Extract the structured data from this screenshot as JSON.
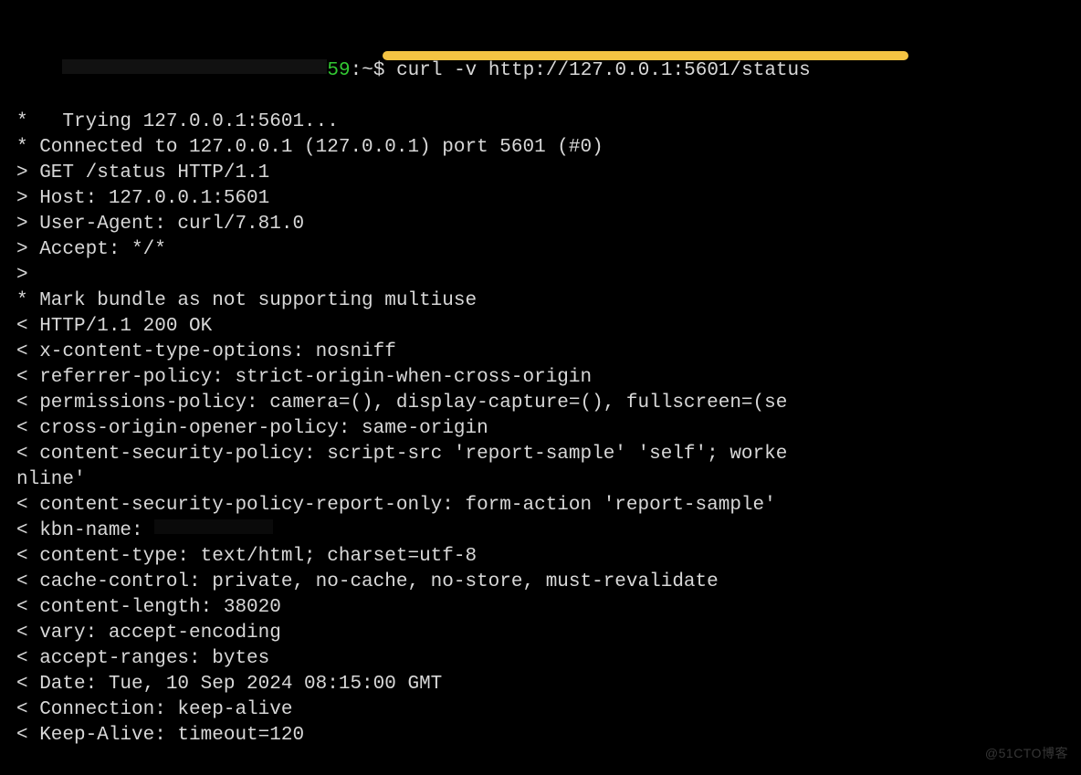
{
  "prompt": {
    "visible_fragment_a": "59",
    "path": ":~$",
    "command": "curl -v http://127.0.0.1:5601/status"
  },
  "lines": {
    "l01": "*   Trying 127.0.0.1:5601...",
    "l02": "* Connected to 127.0.0.1 (127.0.0.1) port 5601 (#0)",
    "l03": "> GET /status HTTP/1.1",
    "l04": "> Host: 127.0.0.1:5601",
    "l05": "> User-Agent: curl/7.81.0",
    "l06": "> Accept: */*",
    "l07": ">",
    "l08": "* Mark bundle as not supporting multiuse",
    "l09": "< HTTP/1.1 200 OK",
    "l10": "< x-content-type-options: nosniff",
    "l11": "< referrer-policy: strict-origin-when-cross-origin",
    "l12": "< permissions-policy: camera=(), display-capture=(), fullscreen=(se",
    "l13": "< cross-origin-opener-policy: same-origin",
    "l14": "< content-security-policy: script-src 'report-sample' 'self'; worke",
    "l15": "nline'",
    "l16": "< content-security-policy-report-only: form-action 'report-sample' ",
    "l17": "< kbn-name: ",
    "l18": "< content-type: text/html; charset=utf-8",
    "l19": "< cache-control: private, no-cache, no-store, must-revalidate",
    "l20": "< content-length: 38020",
    "l21": "< vary: accept-encoding",
    "l22": "< accept-ranges: bytes",
    "l23": "< Date: Tue, 10 Sep 2024 08:15:00 GMT",
    "l24": "< Connection: keep-alive",
    "l25": "< Keep-Alive: timeout=120"
  },
  "watermark": "@51CTO博客"
}
